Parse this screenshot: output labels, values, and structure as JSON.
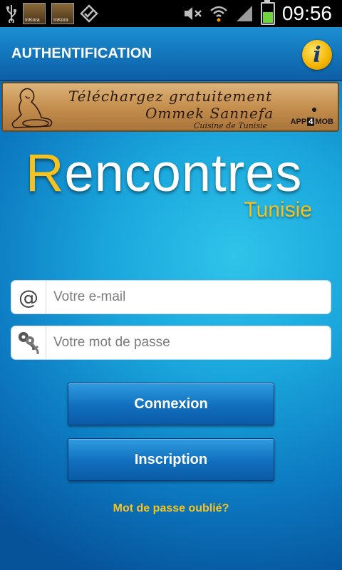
{
  "status_bar": {
    "time": "09:56",
    "notifications": [
      {
        "icon": "usb-icon"
      },
      {
        "icon": "app-thumbnail-icon",
        "label": "InKora"
      },
      {
        "icon": "app-thumbnail-icon",
        "label": "InKora"
      },
      {
        "icon": "checkbox-notification-icon"
      }
    ],
    "system_icons": [
      "mute-icon",
      "wifi-icon",
      "signal-icon",
      "battery-charging-icon"
    ]
  },
  "header": {
    "title": "AUTHENTIFICATION",
    "info_icon": "info-icon",
    "info_glyph": "i"
  },
  "ad_banner": {
    "line1": "Téléchargez gratuitement",
    "line2": "Ommek Sannefa",
    "line3": "Cuisine de Tunisie",
    "brand_prefix": "APP",
    "brand_mid": "4",
    "brand_suffix": "MOB"
  },
  "logo": {
    "first_letter": "R",
    "rest": "encontres",
    "subtitle": "Tunisie"
  },
  "form": {
    "email": {
      "icon": "at-icon",
      "glyph": "@",
      "placeholder": "Votre e-mail",
      "value": ""
    },
    "password": {
      "icon": "key-icon",
      "placeholder": "Votre mot de passe",
      "value": ""
    },
    "login_label": "Connexion",
    "register_label": "Inscription",
    "forgot_label": "Mot de passe oublié?"
  },
  "colors": {
    "accent_yellow": "#f7c21c",
    "header_blue": "#0d5ea6",
    "button_blue": "#116fbe"
  }
}
